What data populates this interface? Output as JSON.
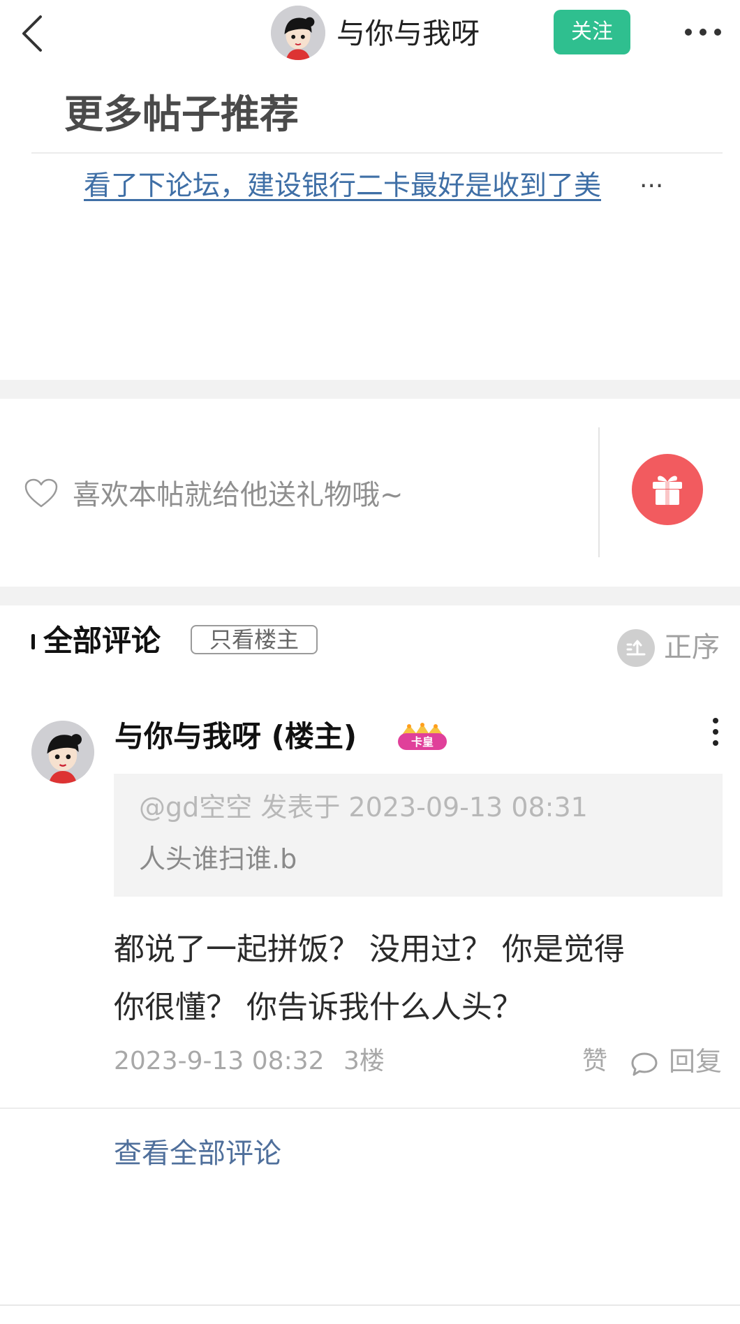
{
  "header": {
    "back_icon": "chevron-left-icon",
    "avatar_icon": "cartoon-avatar-icon",
    "username": "与你与我呀",
    "follow_label": "关注",
    "more_icon": "more-horizontal-icon",
    "accent_color": "#2fbf8f"
  },
  "more_posts": {
    "title": "更多帖子推荐",
    "link_text": "看了下论坛，建设银行二卡最好是收到了美",
    "ellipsis": "···",
    "link_color": "#3f6fa6"
  },
  "gift": {
    "heart_icon": "heart-outline-icon",
    "prompt": "喜欢本帖就给他送礼物哦~",
    "gift_icon": "gift-icon",
    "gift_color": "#f25b5f"
  },
  "comments": {
    "title": "全部评论",
    "only_op_label": "只看楼主",
    "sort_icon": "sort-icon",
    "sort_label": "正序",
    "items": [
      {
        "author": "与你与我呀 (楼主)",
        "badge_text": "卡皇",
        "badge_icon": "crown-badge-icon",
        "quote_meta": "@gd空空 发表于 2023-09-13 08:31",
        "quote_text": "人头谁扫谁.b",
        "body_line1": "都说了一起拼饭？  没用过？  你是觉得",
        "body_line2": "你很懂？  你告诉我什么人头？",
        "time": "2023-9-13 08:32",
        "floor": "3楼",
        "like_label": "赞",
        "reply_icon": "comment-bubble-icon",
        "reply_label": "回复"
      }
    ],
    "view_all_label": "查看全部评论"
  }
}
